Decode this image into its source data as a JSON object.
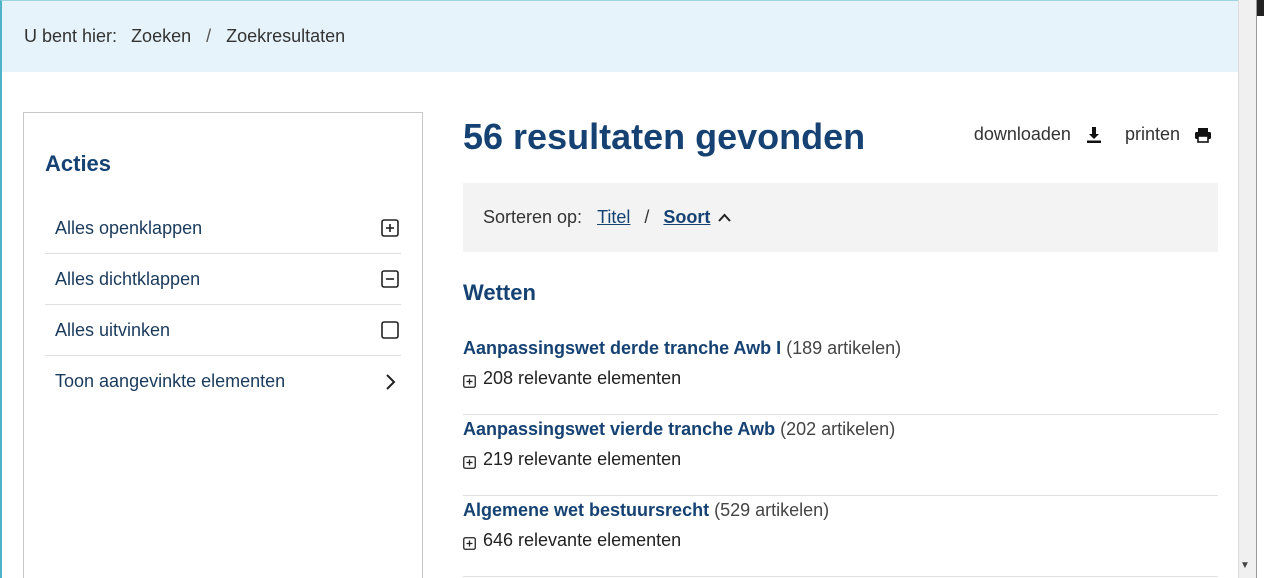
{
  "breadcrumb": {
    "label": "U bent hier:",
    "items": [
      "Zoeken",
      "Zoekresultaten"
    ]
  },
  "actions": {
    "title": "Acties",
    "items": [
      {
        "label": "Alles openklappen",
        "icon": "plus-square-icon"
      },
      {
        "label": "Alles dichtklappen",
        "icon": "minus-square-icon"
      },
      {
        "label": "Alles uitvinken",
        "icon": "checkbox-icon"
      },
      {
        "label": "Toon aangevinkte elementen",
        "icon": "chevron-right-icon"
      }
    ]
  },
  "main": {
    "title": "56 resultaten gevonden",
    "download_label": "downloaden",
    "print_label": "printen",
    "sort": {
      "label": "Sorteren op:",
      "options": [
        "Titel",
        "Soort"
      ],
      "active": "Soort"
    },
    "section": "Wetten",
    "results": [
      {
        "title": "Aanpassingswet derde tranche Awb I",
        "count": "(189 artikelen)",
        "relevant": "208 relevante elementen"
      },
      {
        "title": "Aanpassingswet vierde tranche Awb",
        "count": "(202 artikelen)",
        "relevant": "219 relevante elementen"
      },
      {
        "title": "Algemene wet bestuursrecht",
        "count": "(529 artikelen)",
        "relevant": "646 relevante elementen"
      }
    ]
  },
  "colors": {
    "accent": "#154273",
    "breadcrumb_bg": "#e6f3fa",
    "sort_bg": "#f3f3f3"
  }
}
